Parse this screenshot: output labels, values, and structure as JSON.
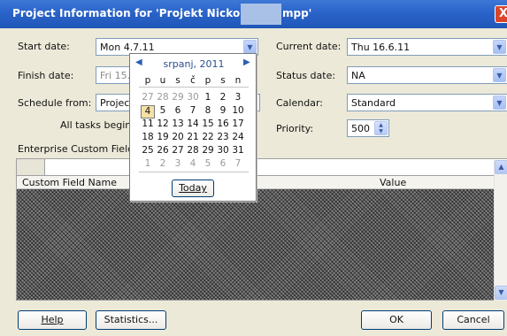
{
  "window": {
    "title": "Project Information for 'Projekt Nickol",
    "title_tail": "mpp'",
    "close_glyph": "X"
  },
  "fields": {
    "start_date": {
      "label": "Start date:",
      "value": "Mon 4.7.11"
    },
    "finish_date": {
      "label": "Finish date:",
      "value": "Fri 15."
    },
    "schedule_from": {
      "label": "Schedule from:",
      "value": "Projec"
    },
    "schedule_hint": "All tasks begin a",
    "current_date": {
      "label": "Current date:",
      "value": "Thu 16.6.11"
    },
    "status_date": {
      "label": "Status date:",
      "value": "NA"
    },
    "calendar": {
      "label": "Calendar:",
      "value": "Standard"
    },
    "priority": {
      "label": "Priority:",
      "value": "500"
    }
  },
  "custom_fields": {
    "section_label": "Enterprise Custom Fields",
    "columns": [
      "Custom Field Name",
      "Value"
    ]
  },
  "calendar_popup": {
    "month_label": "srpanj, 2011",
    "prev_glyph": "◀",
    "next_glyph": "▶",
    "weekdays": [
      "p",
      "u",
      "s",
      "č",
      "p",
      "s",
      "n"
    ],
    "weeks": [
      [
        {
          "d": "27",
          "m": true
        },
        {
          "d": "28",
          "m": true
        },
        {
          "d": "29",
          "m": true
        },
        {
          "d": "30",
          "m": true
        },
        {
          "d": "1"
        },
        {
          "d": "2"
        },
        {
          "d": "3"
        }
      ],
      [
        {
          "d": "4",
          "sel": true
        },
        {
          "d": "5"
        },
        {
          "d": "6"
        },
        {
          "d": "7"
        },
        {
          "d": "8"
        },
        {
          "d": "9"
        },
        {
          "d": "10"
        }
      ],
      [
        {
          "d": "11"
        },
        {
          "d": "12"
        },
        {
          "d": "13"
        },
        {
          "d": "14"
        },
        {
          "d": "15"
        },
        {
          "d": "16"
        },
        {
          "d": "17"
        }
      ],
      [
        {
          "d": "18"
        },
        {
          "d": "19"
        },
        {
          "d": "20"
        },
        {
          "d": "21"
        },
        {
          "d": "22"
        },
        {
          "d": "23"
        },
        {
          "d": "24"
        }
      ],
      [
        {
          "d": "25"
        },
        {
          "d": "26"
        },
        {
          "d": "27"
        },
        {
          "d": "28"
        },
        {
          "d": "29"
        },
        {
          "d": "30"
        },
        {
          "d": "31"
        }
      ],
      [
        {
          "d": "1",
          "m": true
        },
        {
          "d": "2",
          "m": true
        },
        {
          "d": "3",
          "m": true
        },
        {
          "d": "4",
          "m": true
        },
        {
          "d": "5",
          "m": true
        },
        {
          "d": "6",
          "m": true
        },
        {
          "d": "7",
          "m": true
        }
      ]
    ],
    "today_label": "Today"
  },
  "buttons": {
    "help": "Help",
    "statistics": "Statistics...",
    "ok": "OK",
    "cancel": "Cancel"
  },
  "icons": {
    "dropdown": "chevron-down-icon",
    "spin": "spin-updown-icon",
    "scroll_up": "scroll-up-icon",
    "scroll_down": "scroll-down-icon"
  },
  "colors": {
    "titlebar": "#2a63c9",
    "dialog_bg": "#ece9d8",
    "selected_day": "#f6e1a4"
  }
}
